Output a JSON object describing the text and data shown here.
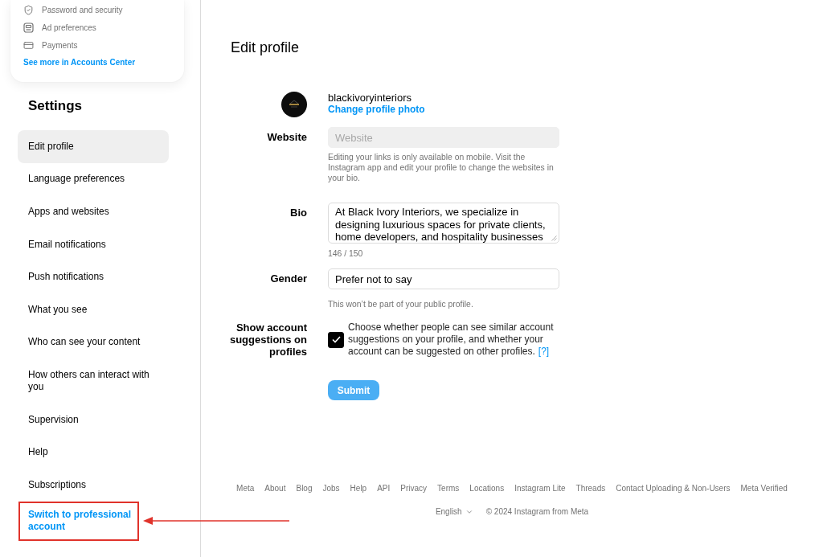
{
  "accounts_center": {
    "items": [
      {
        "kind": "security",
        "label": "Password and security"
      },
      {
        "kind": "ads",
        "label": "Ad preferences"
      },
      {
        "kind": "payments",
        "label": "Payments"
      }
    ],
    "link": "See more in Accounts Center"
  },
  "settings": {
    "title": "Settings",
    "items": [
      {
        "label": "Edit profile",
        "kind": "item",
        "selected": true,
        "highlighted": false
      },
      {
        "label": "Language preferences",
        "kind": "item",
        "selected": false,
        "highlighted": false
      },
      {
        "label": "Apps and websites",
        "kind": "item",
        "selected": false,
        "highlighted": false
      },
      {
        "label": "Email notifications",
        "kind": "item",
        "selected": false,
        "highlighted": false
      },
      {
        "label": "Push notifications",
        "kind": "item",
        "selected": false,
        "highlighted": false
      },
      {
        "label": "What you see",
        "kind": "item",
        "selected": false,
        "highlighted": false
      },
      {
        "label": "Who can see your content",
        "kind": "item",
        "selected": false,
        "highlighted": false
      },
      {
        "label": "How others can interact with you",
        "kind": "item",
        "selected": false,
        "highlighted": false
      },
      {
        "label": "Supervision",
        "kind": "item",
        "selected": false,
        "highlighted": false
      },
      {
        "label": "Help",
        "kind": "item",
        "selected": false,
        "highlighted": false
      },
      {
        "label": "Subscriptions",
        "kind": "item",
        "selected": false,
        "highlighted": false
      },
      {
        "label": "Switch to professional account",
        "kind": "link",
        "selected": false,
        "highlighted": true
      }
    ]
  },
  "main": {
    "title": "Edit profile",
    "profile": {
      "username": "blackivoryinteriors",
      "change_photo": "Change profile photo"
    },
    "fields": [
      {
        "kind": "input",
        "label": "Website",
        "placeholder": "Website",
        "disabled": true,
        "note": "Editing your links is only available on mobile. Visit the Instagram app and edit your profile to change the websites in your bio."
      },
      {
        "kind": "textarea",
        "label": "Bio",
        "value": "At Black Ivory Interiors, we specialize in designing luxurious spaces for private clients, home developers, and hospitality businesses",
        "disabled": false,
        "note": "146 / 150"
      },
      {
        "kind": "input",
        "label": "Gender",
        "value": "Prefer not to say",
        "disabled": false,
        "note": "This won’t be part of your public profile."
      }
    ],
    "suggestions": {
      "label": "Show account suggestions on profiles",
      "checked": true,
      "text": "Choose whether people can see similar account suggestions on your profile, and whether your account can be suggested on other profiles.",
      "help_link": "[?]"
    },
    "submit": {
      "label": "Submit",
      "disabled": true
    }
  },
  "footer": {
    "links": [
      "Meta",
      "About",
      "Blog",
      "Jobs",
      "Help",
      "API",
      "Privacy",
      "Terms",
      "Locations",
      "Instagram Lite",
      "Threads",
      "Contact Uploading & Non-Users",
      "Meta Verified"
    ],
    "language": "English",
    "copyright": "© 2024 Instagram from Meta"
  }
}
